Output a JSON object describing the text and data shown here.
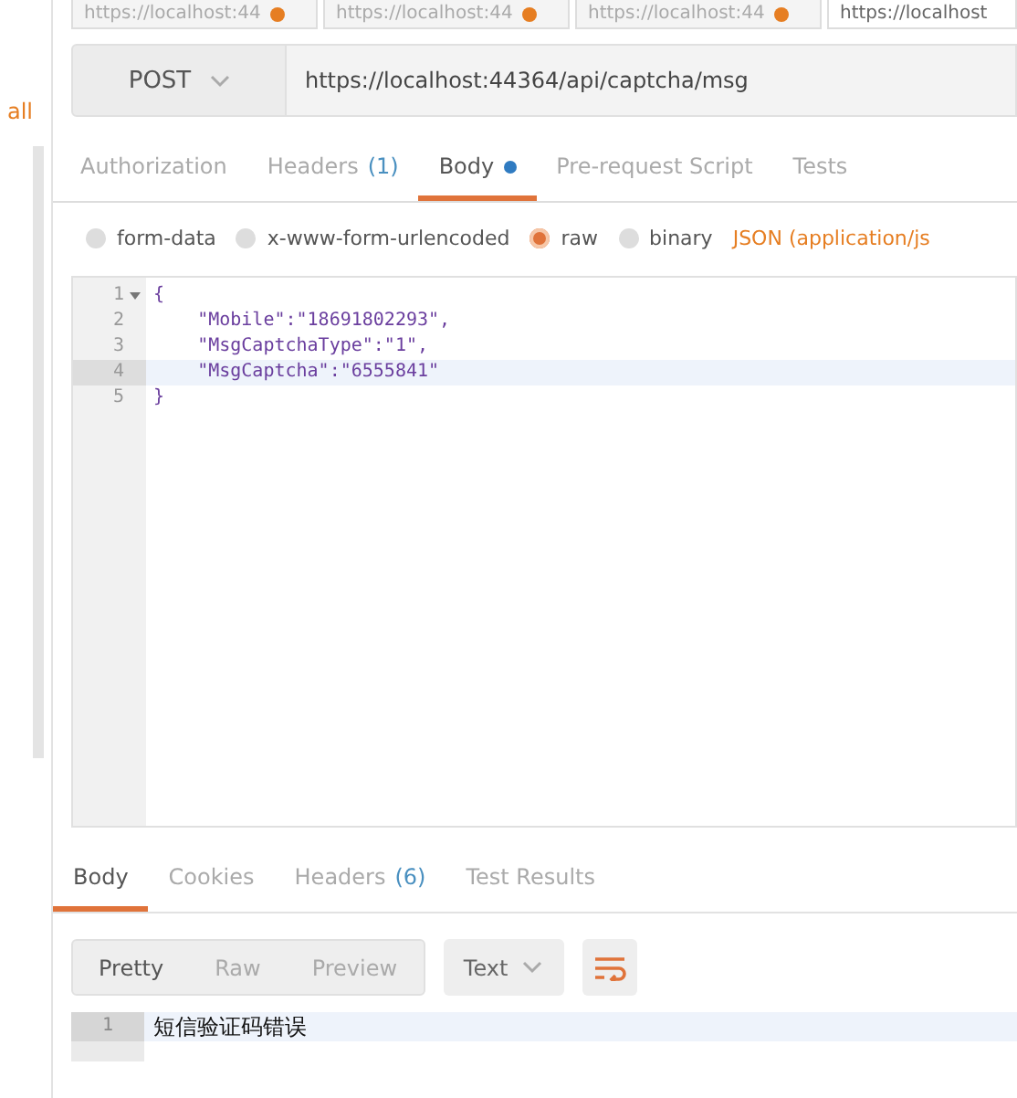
{
  "request_tabs": [
    {
      "label": "https://localhost:44",
      "selected": false,
      "unsaved": true
    },
    {
      "label": "https://localhost:44",
      "selected": false,
      "unsaved": true
    },
    {
      "label": "https://localhost:44",
      "selected": false,
      "unsaved": true
    },
    {
      "label": "https://localhost",
      "selected": true,
      "unsaved": false
    }
  ],
  "sidebar": {
    "link": "all"
  },
  "request": {
    "method": "POST",
    "url": "https://localhost:44364/api/captcha/msg"
  },
  "request_tabs_bar": [
    {
      "label": "Authorization",
      "selected": false
    },
    {
      "label": "Headers",
      "count": "(1)",
      "selected": false
    },
    {
      "label": "Body",
      "selected": true,
      "dot": true
    },
    {
      "label": "Pre-request Script",
      "selected": false
    },
    {
      "label": "Tests",
      "selected": false
    }
  ],
  "body_types": [
    {
      "label": "form-data",
      "selected": false
    },
    {
      "label": "x-www-form-urlencoded",
      "selected": false
    },
    {
      "label": "raw",
      "selected": true
    },
    {
      "label": "binary",
      "selected": false
    }
  ],
  "content_type": "JSON (application/js",
  "editor_lines": [
    {
      "number": "1",
      "text": "{",
      "fold": true,
      "active": false
    },
    {
      "number": "2",
      "text": "    \"Mobile\":\"18691802293\",",
      "fold": false,
      "active": false
    },
    {
      "number": "3",
      "text": "    \"MsgCaptchaType\":\"1\",",
      "fold": false,
      "active": false
    },
    {
      "number": "4",
      "text": "    \"MsgCaptcha\":\"6555841\"",
      "fold": false,
      "active": true
    },
    {
      "number": "5",
      "text": "}",
      "fold": false,
      "active": false
    }
  ],
  "response_tabs": [
    {
      "label": "Body",
      "selected": true
    },
    {
      "label": "Cookies",
      "selected": false
    },
    {
      "label": "Headers",
      "count": "(6)",
      "selected": false
    },
    {
      "label": "Test Results",
      "selected": false
    }
  ],
  "view_modes": [
    {
      "label": "Pretty",
      "selected": true
    },
    {
      "label": "Raw",
      "selected": false
    },
    {
      "label": "Preview",
      "selected": false
    }
  ],
  "format": "Text",
  "response_lines": [
    {
      "number": "1",
      "text": "短信验证码错误"
    }
  ]
}
